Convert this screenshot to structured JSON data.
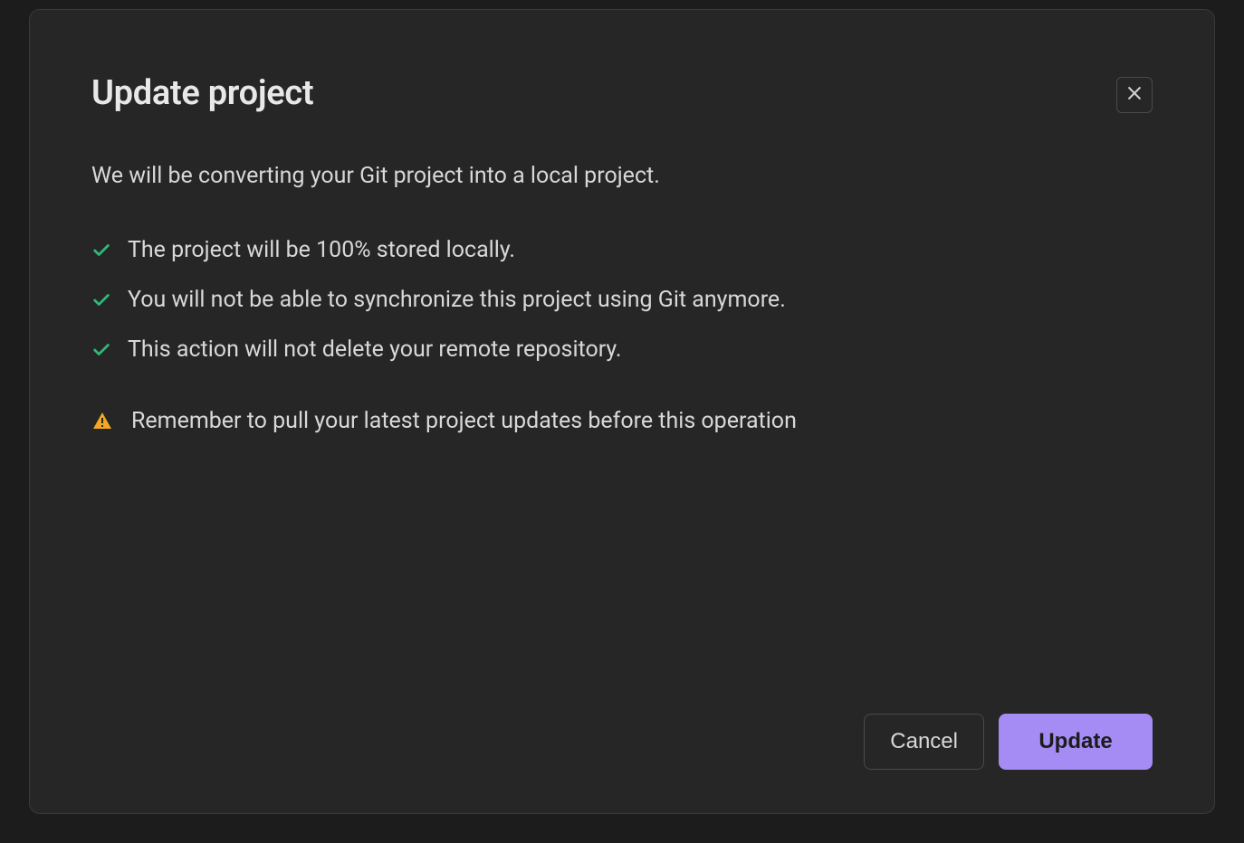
{
  "dialog": {
    "title": "Update project",
    "description": "We will be converting your Git project into a local project.",
    "checklist": [
      "The project will be 100% stored locally.",
      "You will not be able to synchronize this project using Git anymore.",
      "This action will not delete your remote repository."
    ],
    "warning": "Remember to pull your latest project updates before this operation",
    "buttons": {
      "cancel": "Cancel",
      "confirm": "Update"
    }
  },
  "colors": {
    "check": "#2fb977",
    "warning": "#f5a623",
    "primary": "#a58cf5"
  }
}
